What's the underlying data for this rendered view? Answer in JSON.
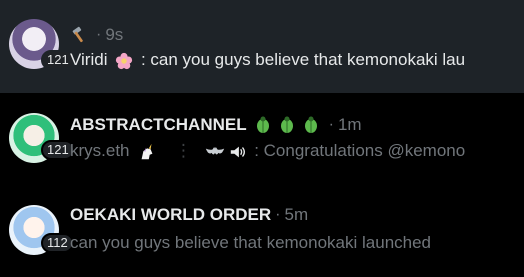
{
  "rows": [
    {
      "name": "",
      "badge_icon": "hammer-icon",
      "time": "9s",
      "count": "121",
      "author": "Viridi",
      "author_icon": "flower-icon",
      "message": ": can you guys believe that kemonokaki launched"
    },
    {
      "name": "ABSTRACTCHANNEL",
      "badge_icons": [
        "bug-icon",
        "bug-icon",
        "bug-icon"
      ],
      "time": "1m",
      "count": "121",
      "author": "krys.eth",
      "author_icon": "unicorn-icon",
      "separator": "⋮",
      "sub_icons": [
        "bat-icon",
        "speaker-icon"
      ],
      "message": ": Congratulations @kemonokaki"
    },
    {
      "name": "OEKAKI WORLD ORDER",
      "time": "5m",
      "count": "112",
      "message": "can you guys believe that kemonokaki launched"
    }
  ],
  "colors": {
    "background": "#000000",
    "selected_row": "#1e2328",
    "primary_text": "#e7e9ea",
    "secondary_text": "#71767b"
  }
}
